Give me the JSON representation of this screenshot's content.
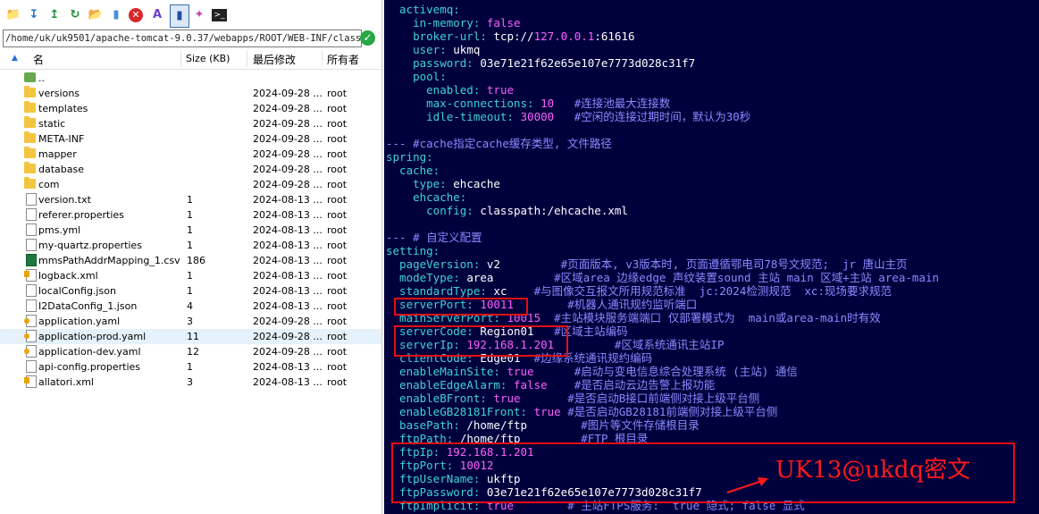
{
  "file_panel": {
    "path": "/home/uk/uk9501/apache-tomcat-9.0.37/webapps/ROOT/WEB-INF/classes/",
    "columns": {
      "name": "名",
      "size": "Size (KB)",
      "modified": "最后修改",
      "owner": "所有者"
    },
    "rows": [
      {
        "name": "..",
        "type": "up",
        "size": "",
        "date": "",
        "owner": ""
      },
      {
        "name": "versions",
        "type": "folder",
        "size": "",
        "date": "2024-09-28 ...",
        "owner": "root"
      },
      {
        "name": "templates",
        "type": "folder",
        "size": "",
        "date": "2024-09-28 ...",
        "owner": "root"
      },
      {
        "name": "static",
        "type": "folder",
        "size": "",
        "date": "2024-09-28 ...",
        "owner": "root"
      },
      {
        "name": "META-INF",
        "type": "folder",
        "size": "",
        "date": "2024-09-28 ...",
        "owner": "root"
      },
      {
        "name": "mapper",
        "type": "folder",
        "size": "",
        "date": "2024-09-28 ...",
        "owner": "root"
      },
      {
        "name": "database",
        "type": "folder",
        "size": "",
        "date": "2024-09-28 ...",
        "owner": "root"
      },
      {
        "name": "com",
        "type": "folder",
        "size": "",
        "date": "2024-09-28 ...",
        "owner": "root"
      },
      {
        "name": "version.txt",
        "type": "file",
        "size": "1",
        "date": "2024-08-13 ...",
        "owner": "root"
      },
      {
        "name": "referer.properties",
        "type": "file",
        "size": "1",
        "date": "2024-08-13 ...",
        "owner": "root"
      },
      {
        "name": "pms.yml",
        "type": "file",
        "size": "1",
        "date": "2024-08-13 ...",
        "owner": "root"
      },
      {
        "name": "my-quartz.properties",
        "type": "file",
        "size": "1",
        "date": "2024-08-13 ...",
        "owner": "root"
      },
      {
        "name": "mmsPathAddrMapping_1.csv",
        "type": "csv",
        "size": "186",
        "date": "2024-08-13 ...",
        "owner": "root"
      },
      {
        "name": "logback.xml",
        "type": "xml",
        "size": "1",
        "date": "2024-08-13 ...",
        "owner": "root"
      },
      {
        "name": "localConfig.json",
        "type": "file",
        "size": "1",
        "date": "2024-08-13 ...",
        "owner": "root"
      },
      {
        "name": "I2DataConfig_1.json",
        "type": "file",
        "size": "4",
        "date": "2024-08-13 ...",
        "owner": "root"
      },
      {
        "name": "application.yaml",
        "type": "yaml",
        "size": "3",
        "date": "2024-09-28 ...",
        "owner": "root"
      },
      {
        "name": "application-prod.yaml",
        "type": "yaml",
        "size": "11",
        "date": "2024-09-28 ...",
        "owner": "root",
        "selected": true
      },
      {
        "name": "application-dev.yaml",
        "type": "yaml",
        "size": "12",
        "date": "2024-09-28 ...",
        "owner": "root"
      },
      {
        "name": "api-config.properties",
        "type": "file",
        "size": "1",
        "date": "2024-08-13 ...",
        "owner": "root"
      },
      {
        "name": "allatori.xml",
        "type": "xml",
        "size": "3",
        "date": "2024-08-13 ...",
        "owner": "root"
      }
    ],
    "toolbar_icons": [
      "open-folder-icon",
      "download-icon",
      "upload-icon",
      "refresh-icon",
      "new-folder-icon",
      "new-file-icon",
      "delete-icon",
      "text-editor-icon",
      "bookmark-icon",
      "magic-wand-icon",
      "terminal-icon"
    ]
  },
  "terminal": {
    "lines": [
      [
        [
          "k",
          "  activemq:"
        ]
      ],
      [
        [
          "k",
          "    in-memory: "
        ],
        [
          "v",
          "false"
        ]
      ],
      [
        [
          "k",
          "    broker-url: "
        ],
        [
          "w",
          "tcp://"
        ],
        [
          "v",
          "127.0.0.1"
        ],
        [
          "w",
          ":61616"
        ]
      ],
      [
        [
          "k",
          "    user: "
        ],
        [
          "w",
          "ukmq"
        ]
      ],
      [
        [
          "k",
          "    password: "
        ],
        [
          "w",
          "03e71e21f62e65e107e7773d028c31f7"
        ]
      ],
      [
        [
          "k",
          "    pool:"
        ]
      ],
      [
        [
          "k",
          "      enabled: "
        ],
        [
          "v",
          "true"
        ]
      ],
      [
        [
          "k",
          "      max-connections: "
        ],
        [
          "v",
          "10"
        ],
        [
          "c",
          "   #连接池最大连接数"
        ]
      ],
      [
        [
          "k",
          "      idle-timeout: "
        ],
        [
          "v",
          "30000"
        ],
        [
          "c",
          "   #空闲的连接过期时间，默认为30秒"
        ]
      ],
      [
        [
          "w",
          ""
        ]
      ],
      [
        [
          "c",
          "--- #cache指定cache缓存类型, 文件路径"
        ]
      ],
      [
        [
          "k",
          "spring:"
        ]
      ],
      [
        [
          "k",
          "  cache:"
        ]
      ],
      [
        [
          "k",
          "    type: "
        ],
        [
          "w",
          "ehcache"
        ]
      ],
      [
        [
          "k",
          "    ehcache:"
        ]
      ],
      [
        [
          "k",
          "      config: "
        ],
        [
          "w",
          "classpath:/ehcache.xml"
        ]
      ],
      [
        [
          "w",
          ""
        ]
      ],
      [
        [
          "c",
          "--- # 自定义配置"
        ]
      ],
      [
        [
          "k",
          "setting:"
        ]
      ],
      [
        [
          "k",
          "  pageVersion: "
        ],
        [
          "w",
          "v2"
        ],
        [
          "c",
          "         #页面版本, v3版本时, 页面遵循鄂电司78号文规范;  jr 唐山主页"
        ]
      ],
      [
        [
          "k",
          "  modeType: "
        ],
        [
          "w",
          "area"
        ],
        [
          "c",
          "         #区域area 边缘edge 声纹装置sound 主站 main 区域+主站 area-main"
        ]
      ],
      [
        [
          "k",
          "  standardType: "
        ],
        [
          "w",
          "xc"
        ],
        [
          "c",
          "    #与图像交互报文所用规范标准  jc:2024检测规范  xc:现场要求规范"
        ]
      ],
      [
        [
          "k",
          "  serverPort: "
        ],
        [
          "v",
          "10011"
        ],
        [
          "c",
          "        #机器人通讯规约监听端口"
        ]
      ],
      [
        [
          "k",
          "  mainServerPort: "
        ],
        [
          "v",
          "10015"
        ],
        [
          "c",
          "  #主站模块服务端端口 仅部署模式为  main或area-main时有效"
        ]
      ],
      [
        [
          "k",
          "  serverCode: "
        ],
        [
          "w",
          "Region01"
        ],
        [
          "c",
          "   #区域主站编码"
        ]
      ],
      [
        [
          "k",
          "  serverIp: "
        ],
        [
          "v",
          "192.168.1.201"
        ],
        [
          "c",
          "         #区域系统通讯主站IP"
        ]
      ],
      [
        [
          "k",
          "  clientCode: "
        ],
        [
          "w",
          "Edge01"
        ],
        [
          "c",
          "  #边缘系统通讯规约编码"
        ]
      ],
      [
        [
          "k",
          "  enableMainSite: "
        ],
        [
          "v",
          "true"
        ],
        [
          "c",
          "      #启动与变电信息综合处理系统 (主站) 通信"
        ]
      ],
      [
        [
          "k",
          "  enableEdgeAlarm: "
        ],
        [
          "v",
          "false"
        ],
        [
          "c",
          "    #是否启动云边告警上报功能"
        ]
      ],
      [
        [
          "k",
          "  enableBFront: "
        ],
        [
          "v",
          "true"
        ],
        [
          "c",
          "       #是否启动B接口前端侧对接上级平台侧"
        ]
      ],
      [
        [
          "k",
          "  enableGB28181Front: "
        ],
        [
          "v",
          "true"
        ],
        [
          "c",
          " #是否启动GB28181前端侧对接上级平台侧"
        ]
      ],
      [
        [
          "k",
          "  basePath: "
        ],
        [
          "w",
          "/home/ftp"
        ],
        [
          "c",
          "        #图片等文件存储根目录"
        ]
      ],
      [
        [
          "k",
          "  ftpPath: "
        ],
        [
          "w",
          "/home/ftp"
        ],
        [
          "c",
          "         #FTP 根目录"
        ]
      ],
      [
        [
          "k",
          "  ftpIp: "
        ],
        [
          "v",
          "192.168.1.201"
        ]
      ],
      [
        [
          "k",
          "  ftpPort: "
        ],
        [
          "v",
          "10012"
        ]
      ],
      [
        [
          "k",
          "  ftpUserName: "
        ],
        [
          "w",
          "ukftp"
        ]
      ],
      [
        [
          "k",
          "  ftpPassword: "
        ],
        [
          "w",
          "03e71e21f62e65e107e7773d028c31f7"
        ]
      ],
      [
        [
          "k",
          "  ftpImplicit: "
        ],
        [
          "v",
          "true"
        ],
        [
          "c",
          "        # 主站FTPS服务:  true 隐式; false 显式"
        ]
      ]
    ],
    "annotation": "UK13@ukdq密文"
  },
  "colors": {
    "terminal_bg": "#00003d",
    "key": "#3fd4d4",
    "value": "#ff5fff",
    "comment": "#8a8aff",
    "highlight_box": "#e01010"
  }
}
